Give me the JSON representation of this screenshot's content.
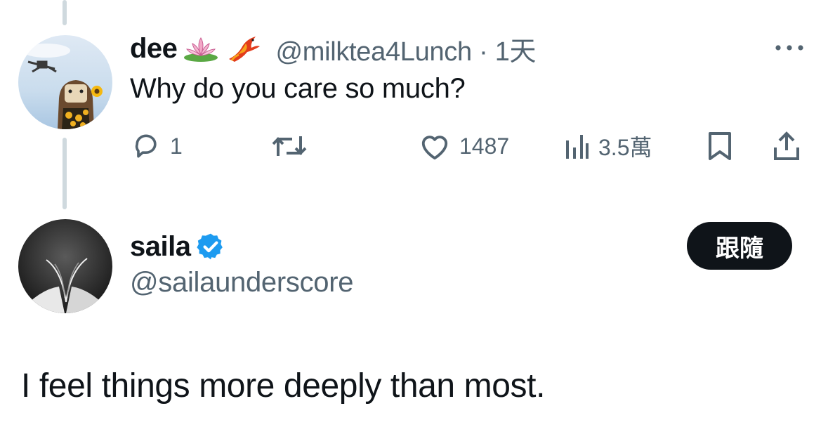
{
  "reply_tweet": {
    "author": {
      "display_name": "dee",
      "emojis": [
        "lotus-emoji",
        "phoenix-emoji"
      ],
      "handle_time": "@milktea4Lunch · 1天"
    },
    "text": "Why do you care so much?",
    "actions": {
      "reply_count": "1",
      "retweet_count": "",
      "like_count": "1487",
      "views_count": "3.5萬"
    }
  },
  "main_tweet": {
    "author": {
      "display_name": "saila",
      "handle": "@sailaunderscore",
      "verified": true
    },
    "follow_label": "跟隨",
    "text": "I feel things more deeply than most."
  },
  "colors": {
    "text_primary": "#0f1419",
    "text_secondary": "#536471",
    "verified_blue": "#1d9bf0",
    "thread_line": "#cfd9de",
    "follow_bg": "#0f1419"
  }
}
